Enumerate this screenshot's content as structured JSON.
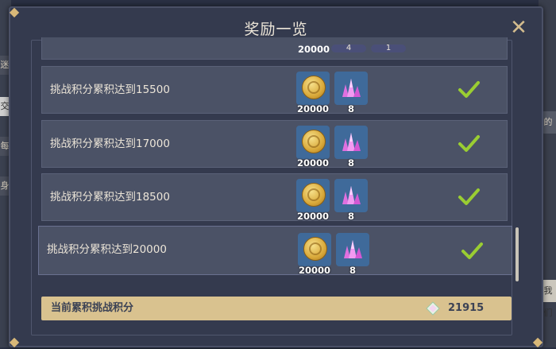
{
  "dialog": {
    "title": "奖励一览",
    "close_icon": "close-icon"
  },
  "background": {
    "left_fragments": [
      "迷",
      "交",
      "每",
      "身"
    ],
    "right_fragments": [
      "的",
      "我们"
    ]
  },
  "partial_row": {
    "coin_count": "20000",
    "pill1": "4",
    "pill2": "1"
  },
  "rows": [
    {
      "label": "挑战积分累积达到15500",
      "coin_count": "20000",
      "crystal_count": "8",
      "claimed": true
    },
    {
      "label": "挑战积分累积达到17000",
      "coin_count": "20000",
      "crystal_count": "8",
      "claimed": true
    },
    {
      "label": "挑战积分累积达到18500",
      "coin_count": "20000",
      "crystal_count": "8",
      "claimed": true
    },
    {
      "label": "挑战积分累积达到20000",
      "coin_count": "20000",
      "crystal_count": "8",
      "claimed": true
    }
  ],
  "footer": {
    "label": "当前累积挑战积分",
    "value": "21915",
    "icon": "gem-icon"
  },
  "colors": {
    "panel_bg": "#343a4e",
    "row_bg": "#4b5266",
    "footer_bg": "#d9c28f",
    "check_green": "#9acd32",
    "gold_accent": "#d3bc8e"
  }
}
